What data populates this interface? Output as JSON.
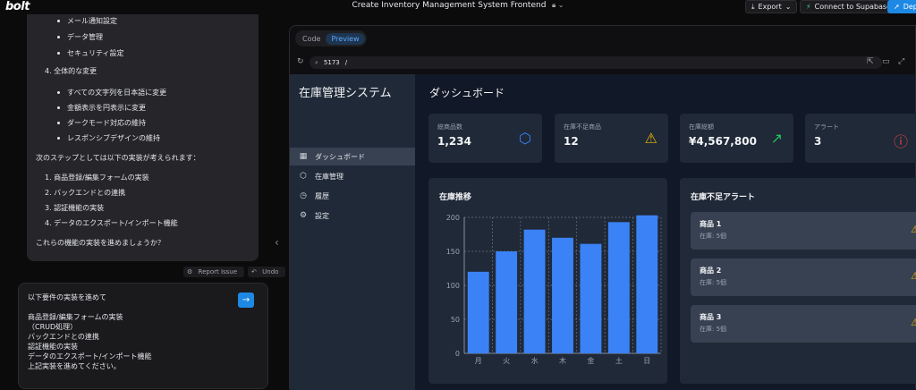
{
  "topbar": {
    "logo": "bolt",
    "project_title": "Create Inventory Management System Frontend",
    "export_label": "Export",
    "supabase_label": "Connect to Supabase",
    "deploy_label": "Dep"
  },
  "chat": {
    "lines": [
      {
        "text": "メール通知設定",
        "type": "bullet"
      },
      {
        "text": "データ管理",
        "type": "bullet"
      },
      {
        "text": "セキュリティ設定",
        "type": "bullet"
      },
      {
        "text": "4. 全体的な変更",
        "type": "num"
      },
      {
        "text": "すべての文字列を日本語に変更",
        "type": "bullet"
      },
      {
        "text": "金額表示を円表示に変更",
        "type": "bullet"
      },
      {
        "text": "ダークモード対応の維持",
        "type": "bullet"
      },
      {
        "text": "レスポンシブデザインの維持",
        "type": "bullet"
      },
      {
        "text": "次のステップとしては以下の実装が考えられます：",
        "type": "para"
      },
      {
        "text": "1. 商品登録/編集フォームの実装",
        "type": "num"
      },
      {
        "text": "2. バックエンドとの連携",
        "type": "num"
      },
      {
        "text": "3. 認証機能の実装",
        "type": "num"
      },
      {
        "text": "4. データのエクスポート/インポート機能",
        "type": "num"
      },
      {
        "text": "これらの機能の実装を進めましょうか？",
        "type": "para"
      }
    ],
    "report_label": "Report Issue",
    "undo_label": "Undo",
    "input_lines": [
      "以下要件の実装を進めて",
      "",
      "商品登録/編集フォームの実装",
      "（CRUD処理）",
      "バックエンドとの連携",
      "認証機能の実装",
      "データのエクスポート/インポート機能",
      "上記実装を進めてください。"
    ]
  },
  "preview": {
    "tab_code": "Code",
    "tab_preview": "Preview",
    "port": "5173",
    "path": "/"
  },
  "app": {
    "title": "在庫管理システム",
    "nav": [
      "ダッシュボード",
      "在庫管理",
      "履歴",
      "設定"
    ],
    "page_title": "ダッシュボード",
    "stats": [
      {
        "label": "総商品数",
        "value": "1,234",
        "icon": "cube-icon",
        "color": "#3b82f6"
      },
      {
        "label": "在庫不足商品",
        "value": "12",
        "icon": "warning-icon",
        "color": "#eab308"
      },
      {
        "label": "在庫総額",
        "value": "¥4,567,800",
        "icon": "trending-up-icon",
        "color": "#22c55e"
      },
      {
        "label": "アラート",
        "value": "3",
        "icon": "alert-circle-icon",
        "color": "#ef4444"
      }
    ],
    "chart_title": "在庫推移",
    "alerts_title": "在庫不足アラート",
    "alerts": [
      {
        "name": "商品 1",
        "stock": "在庫: 5個"
      },
      {
        "name": "商品 2",
        "stock": "在庫: 5個"
      },
      {
        "name": "商品 3",
        "stock": "在庫: 5個"
      }
    ]
  },
  "chart_data": {
    "type": "bar",
    "categories": [
      "月",
      "火",
      "水",
      "木",
      "金",
      "土",
      "日"
    ],
    "values": [
      120,
      150,
      182,
      170,
      161,
      193,
      203
    ],
    "ylim": [
      0,
      200
    ],
    "yticks": [
      0,
      50,
      100,
      150,
      200
    ],
    "color": "#3b82f6",
    "grid": true
  }
}
